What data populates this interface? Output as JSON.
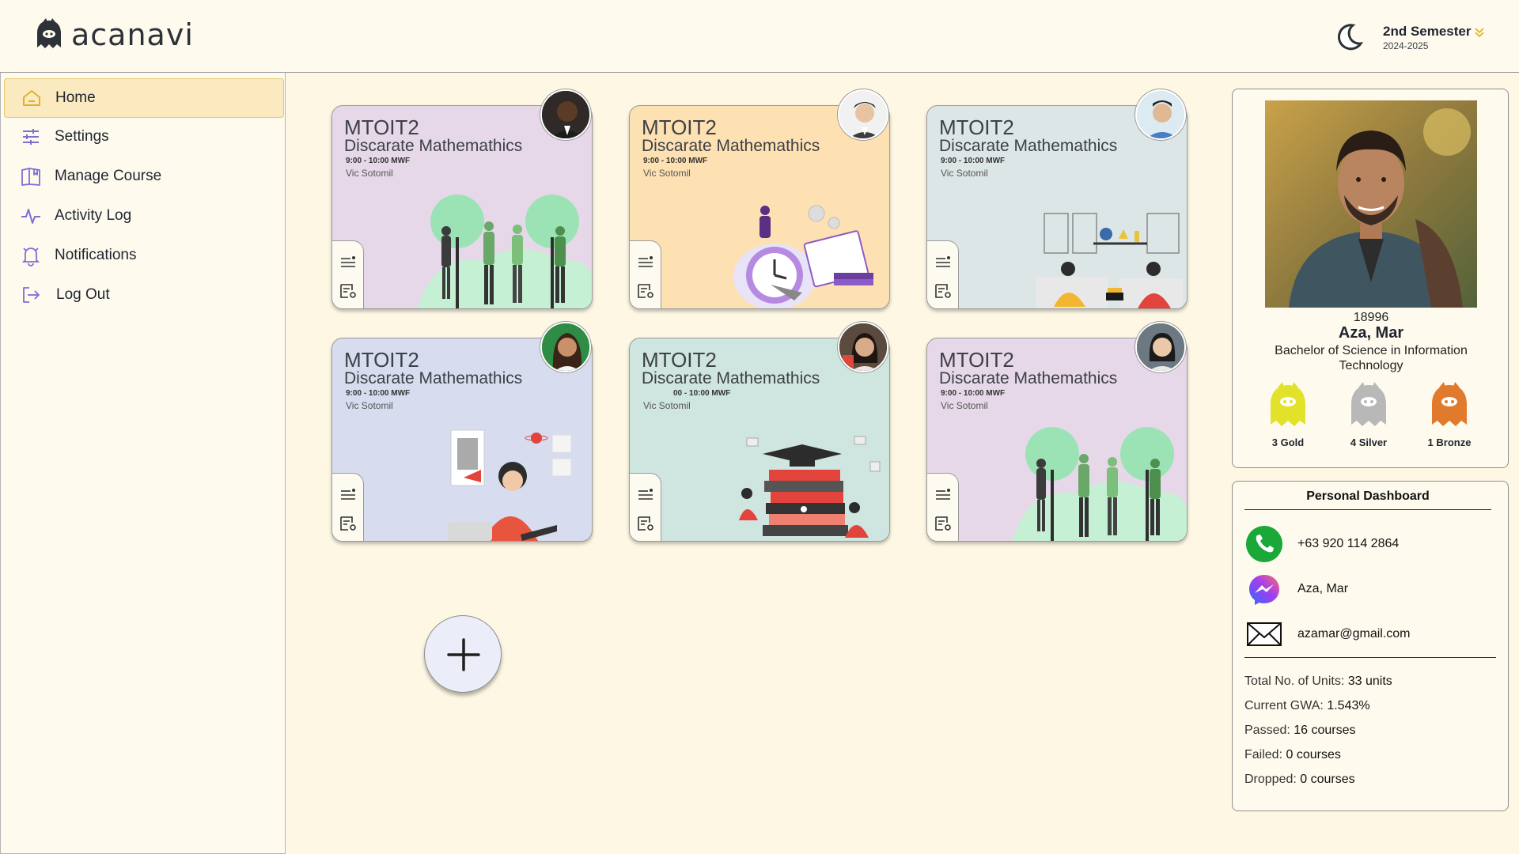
{
  "app": {
    "name": "acanavi"
  },
  "header": {
    "semester": "2nd Semester",
    "year": "2024-2025"
  },
  "sidebar": {
    "items": [
      {
        "label": "Home",
        "icon": "home-icon"
      },
      {
        "label": "Settings",
        "icon": "sliders-icon"
      },
      {
        "label": "Manage Course",
        "icon": "book-icon"
      },
      {
        "label": "Activity Log",
        "icon": "activity-icon"
      },
      {
        "label": "Notifications",
        "icon": "bell-icon"
      },
      {
        "label": "Log Out",
        "icon": "logout-icon"
      }
    ]
  },
  "courses": [
    {
      "code": "MTOIT2",
      "name": "Discarate Mathemathics",
      "schedule": "9:00 - 10:00 MWF",
      "professor": "Vic Sotomil",
      "color": "#e6d8e8"
    },
    {
      "code": "MTOIT2",
      "name": "Discarate Mathemathics",
      "schedule": "9:00 - 10:00 MWF",
      "professor": "Vic Sotomil",
      "color": "#fde1b3"
    },
    {
      "code": "MTOIT2",
      "name": "Discarate Mathemathics",
      "schedule": "9:00 - 10:00 MWF",
      "professor": "Vic Sotomil",
      "color": "#dde6e6"
    },
    {
      "code": "MTOIT2",
      "name": "Discarate Mathemathics",
      "schedule": "9:00 - 10:00 MWF",
      "professor": "Vic Sotomil",
      "color": "#d7dcef"
    },
    {
      "code": "MTOIT2",
      "name": "Discarate Mathemathics",
      "schedule": "00 - 10:00 MWF",
      "professor": "Vic Sotomil",
      "color": "#cfe5df"
    },
    {
      "code": "MTOIT2",
      "name": "Discarate Mathemathics",
      "schedule": "9:00 - 10:00 MWF",
      "professor": "Vic Sotomil",
      "color": "#e6d8e8"
    }
  ],
  "profile": {
    "student_id": "18996",
    "name": "Aza, Mar",
    "program": "Bachelor of Science in Information Technology",
    "medals": [
      {
        "label": "3 Gold",
        "color": "#e3e22a"
      },
      {
        "label": "4 Silver",
        "color": "#b8b8b8"
      },
      {
        "label": "1 Bronze",
        "color": "#e07b2e"
      }
    ]
  },
  "dashboard": {
    "title": "Personal Dashboard",
    "phone": "+63 920 114 2864",
    "messenger": "Aza, Mar",
    "email": "azamar@gmail.com",
    "stats": [
      {
        "label": "Total No. of Units:",
        "value": " 33 units"
      },
      {
        "label": "Current GWA:",
        "value": " 1.543%"
      },
      {
        "label": "Passed:",
        "value": " 16 courses"
      },
      {
        "label": "Failed:",
        "value": " 0 courses"
      },
      {
        "label": "Dropped:",
        "value": " 0 courses"
      }
    ]
  }
}
